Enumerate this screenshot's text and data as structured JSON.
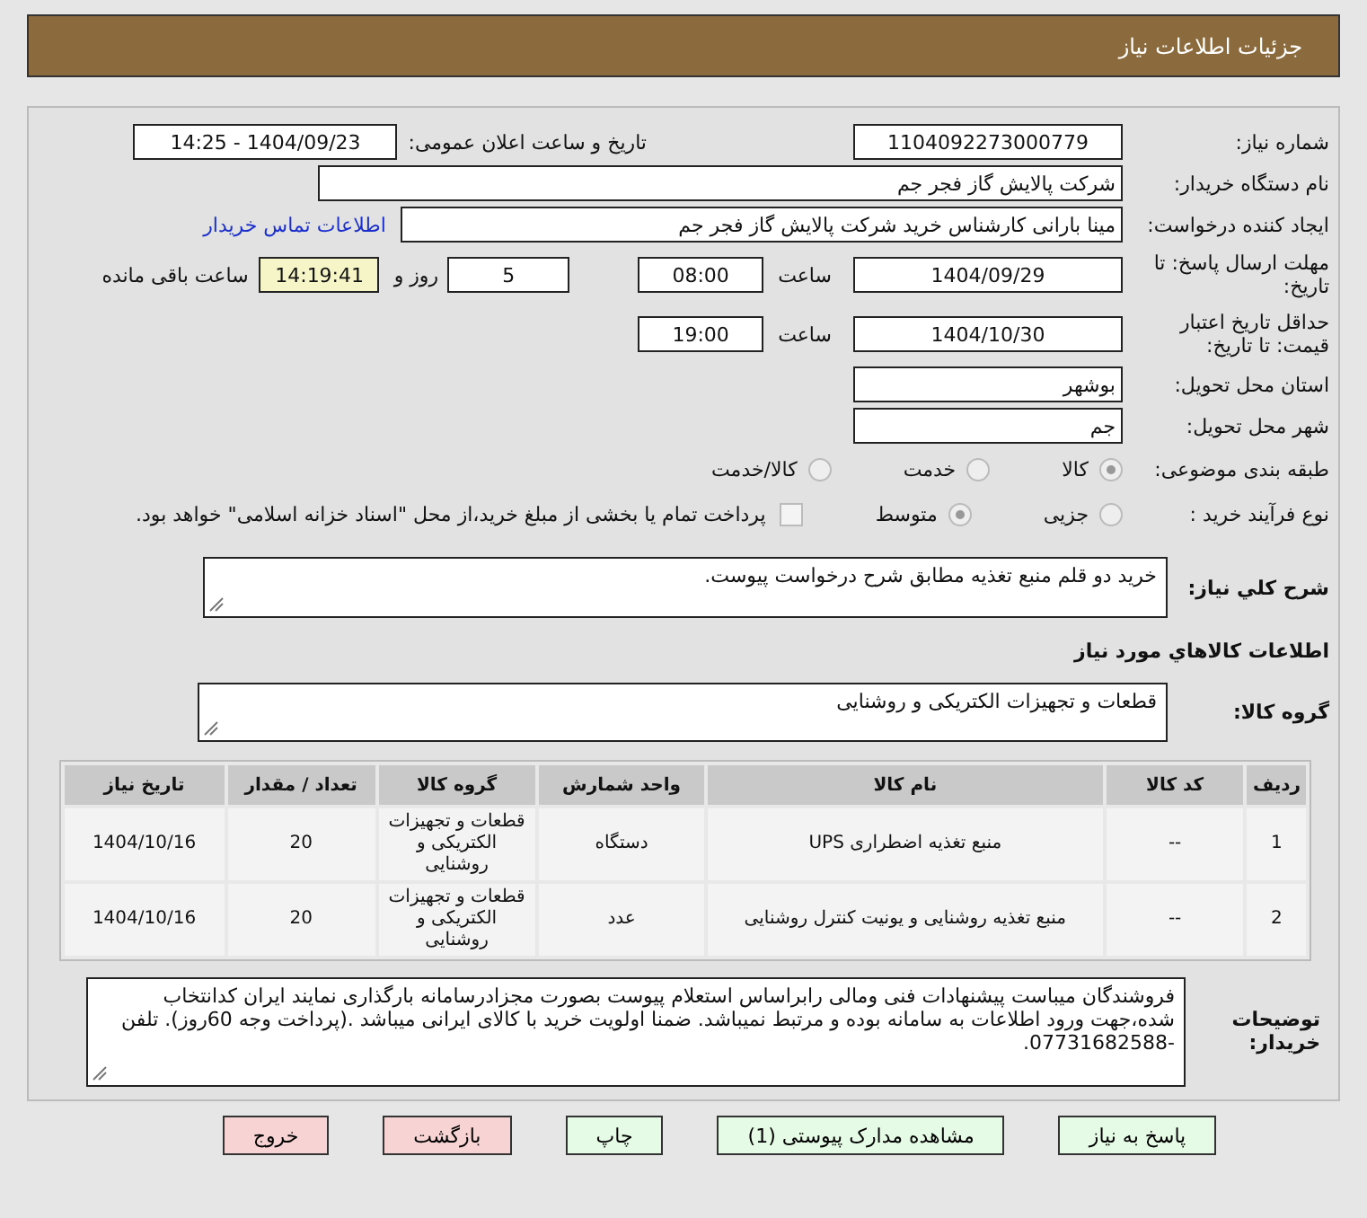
{
  "header": {
    "title": "جزئیات اطلاعات نیاز"
  },
  "fields": {
    "need_number": {
      "label": "شماره نیاز:",
      "value": "1104092273000779"
    },
    "announce": {
      "label": "تاریخ و ساعت اعلان عمومی:",
      "value": "1404/09/23 - 14:25"
    },
    "buyer": {
      "label": "نام دستگاه خریدار:",
      "value": "شرکت پالایش گاز فجر جم"
    },
    "creator": {
      "label": "ایجاد کننده درخواست:",
      "value": "مینا بارانی کارشناس خرید  شرکت پالایش گاز فجر جم",
      "link": "اطلاعات تماس خریدار"
    },
    "deadline": {
      "label": "مهلت ارسال پاسخ: تا تاریخ:",
      "date": "1404/09/29",
      "time_label": "ساعت",
      "time": "08:00",
      "days": "5",
      "days_label": "روز و",
      "remaining": "14:19:41",
      "remaining_label": "ساعت باقی مانده"
    },
    "validity": {
      "label": "حداقل تاریخ اعتبار قیمت: تا تاریخ:",
      "date": "1404/10/30",
      "time_label": "ساعت",
      "time": "19:00"
    },
    "province": {
      "label": "استان محل تحویل:",
      "value": "بوشهر"
    },
    "city": {
      "label": "شهر محل تحویل:",
      "value": "جم"
    },
    "category": {
      "label": "طبقه بندی موضوعی:",
      "options": [
        {
          "label": "کالا",
          "selected": true
        },
        {
          "label": "خدمت",
          "selected": false
        },
        {
          "label": "کالا/خدمت",
          "selected": false
        }
      ]
    },
    "process": {
      "label": "نوع فرآیند خرید :",
      "options": [
        {
          "label": "جزیی",
          "selected": false
        },
        {
          "label": "متوسط",
          "selected": true
        }
      ],
      "treasury": {
        "checked": false,
        "label": "پرداخت تمام یا بخشی از مبلغ خرید،از محل \"اسناد خزانه اسلامی\" خواهد بود."
      }
    }
  },
  "description": {
    "label": "شرح کلي نياز:",
    "value": "خرید دو قلم منبع تغذیه مطابق شرح درخواست پیوست."
  },
  "goods_title": "اطلاعات کالاهاي مورد نياز",
  "goods_group": {
    "label": "گروه کالا:",
    "value": "قطعات و تجهیزات الکتریکی و روشنایی"
  },
  "table": {
    "columns": [
      "ردیف",
      "کد کالا",
      "نام کالا",
      "واحد شمارش",
      "گروه کالا",
      "تعداد / مقدار",
      "تاریخ نیاز"
    ],
    "rows": [
      [
        "1",
        "--",
        "منبع تغذیه اضطراری UPS",
        "دستگاه",
        "قطعات و تجهیزات الکتریکی و روشنایی",
        "20",
        "1404/10/16"
      ],
      [
        "2",
        "--",
        "منبع تغذیه روشنایی و یونیت کنترل روشنایی",
        "عدد",
        "قطعات و تجهیزات الکتریکی و روشنایی",
        "20",
        "1404/10/16"
      ]
    ]
  },
  "notes": {
    "label": "توضیحات خریدار:",
    "value": "فروشندگان میباست پیشنهادات فنی ومالی رابراساس استعلام پیوست بصورت مجزادرسامانه بارگذاری نمایند ایران کدانتخاب شده،جهت ورود اطلاعات به سامانه بوده و مرتبط نمیباشد. ضمنا اولویت خرید با کالای ایرانی میباشد .(پرداخت وجه 60روز). تلفن -07731682588."
  },
  "buttons": [
    {
      "label": "پاسخ به نیاز",
      "kind": "normal"
    },
    {
      "label": "مشاهده مدارک پیوستی (1)",
      "kind": "normal"
    },
    {
      "label": "چاپ",
      "kind": "normal"
    },
    {
      "label": "بازگشت",
      "kind": "exit"
    },
    {
      "label": "خروج",
      "kind": "exit"
    }
  ]
}
